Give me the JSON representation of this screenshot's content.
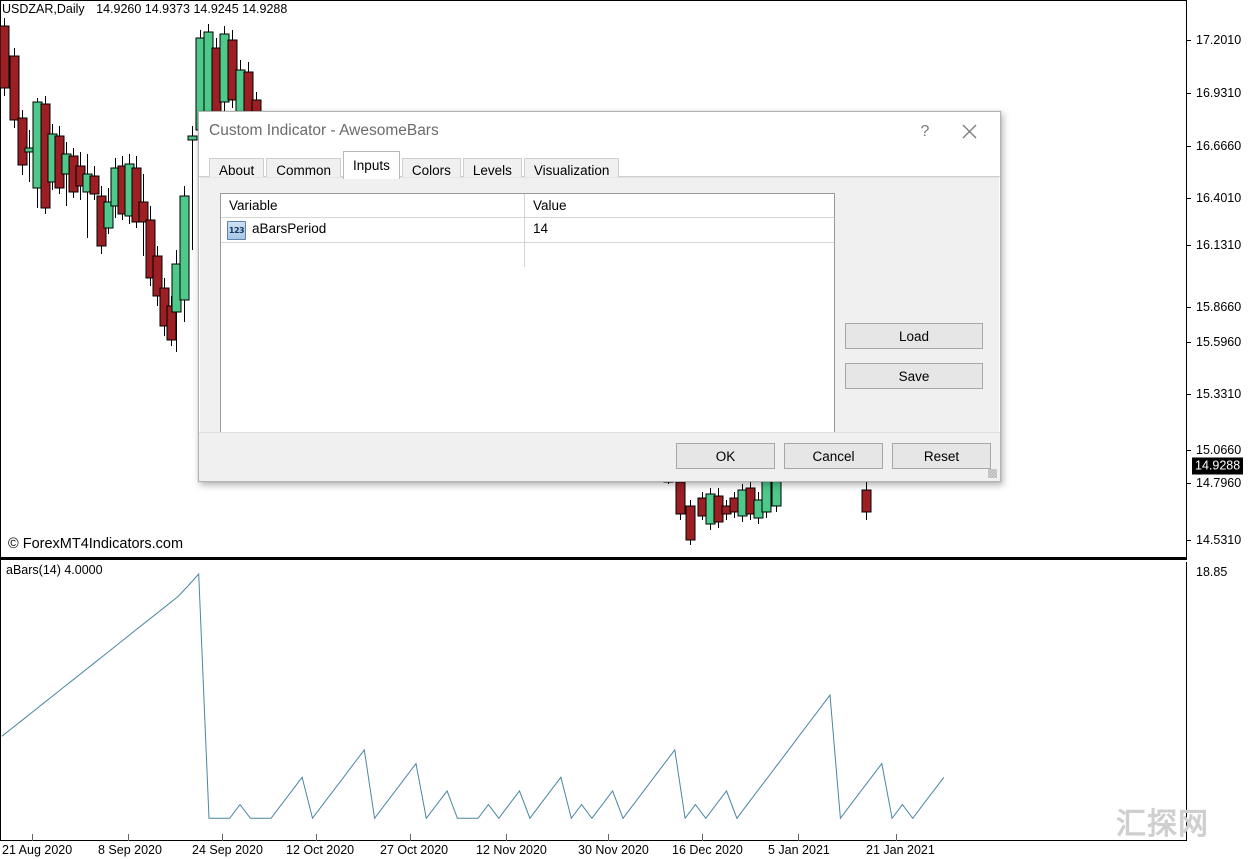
{
  "chart": {
    "symbol_period": "USDZAR,Daily",
    "ohlc": "14.9260 14.9373 14.9245 14.9288",
    "copyright": "© ForexMT4Indicators.com",
    "watermark": "汇探网",
    "indicator_label": "aBars(14) 4.0000",
    "current_price_label": "14.9288",
    "price_labels": [
      "17.2010",
      "16.9310",
      "16.6660",
      "16.4010",
      "16.1310",
      "15.8660",
      "15.5960",
      "15.3310",
      "15.0660",
      "14.7960",
      "14.5310"
    ],
    "sub_price_labels": [
      "18.85"
    ],
    "date_labels": [
      "21 Aug 2020",
      "8 Sep 2020",
      "24 Sep 2020",
      "12 Oct 2020",
      "27 Oct 2020",
      "12 Nov 2020",
      "30 Nov 2020",
      "16 Dec 2020",
      "5 Jan 2021",
      "21 Jan 2021"
    ],
    "colors": {
      "bull_body": "#4ec98a",
      "bear_body": "#9b1f23",
      "candle_outline": "#000000",
      "indicator_line": "#4b86a0",
      "current_price_bg": "#000000",
      "current_price_fg": "#ffffff"
    }
  },
  "chart_data": {
    "type": "line",
    "title": "aBars(14)",
    "xlabel": "",
    "ylabel": "",
    "ylim": [
      0,
      18.85
    ],
    "grid": false,
    "legend": "none",
    "axis_top_label": "18.85",
    "last_value": 4.0,
    "x_tick_labels": [
      "21 Aug 2020",
      "8 Sep 2020",
      "24 Sep 2020",
      "12 Oct 2020",
      "27 Oct 2020",
      "12 Nov 2020",
      "30 Nov 2020",
      "16 Dec 2020",
      "5 Jan 2021",
      "21 Jan 2021"
    ],
    "series": [
      {
        "name": "aBars(14)",
        "color": "#4b86a0",
        "values": [
          7.0,
          7.6,
          8.2,
          8.8,
          9.4,
          10.0,
          10.6,
          11.2,
          11.8,
          12.4,
          13.0,
          13.6,
          14.2,
          14.8,
          15.4,
          16.0,
          16.6,
          17.2,
          18.0,
          18.85,
          1.0,
          1.0,
          1.0,
          2.0,
          1.0,
          1.0,
          1.0,
          2.0,
          3.0,
          4.0,
          1.0,
          2.0,
          3.0,
          4.0,
          5.0,
          6.0,
          1.0,
          2.0,
          3.0,
          4.0,
          5.0,
          1.0,
          2.0,
          3.0,
          1.0,
          1.0,
          1.0,
          2.0,
          1.0,
          2.0,
          3.0,
          1.0,
          2.0,
          3.0,
          4.0,
          1.0,
          2.0,
          1.0,
          2.0,
          3.0,
          1.0,
          2.0,
          3.0,
          4.0,
          5.0,
          6.0,
          1.0,
          2.0,
          1.0,
          2.0,
          3.0,
          1.0,
          2.0,
          3.0,
          4.0,
          5.0,
          6.0,
          7.0,
          8.0,
          9.0,
          10.0,
          1.0,
          2.0,
          3.0,
          4.0,
          5.0,
          1.0,
          2.0,
          1.0,
          2.0,
          3.0,
          4.0
        ]
      }
    ]
  },
  "candles": {
    "bull_color": "#4ec98a",
    "bear_color": "#9b1f23"
  },
  "dialog": {
    "title": "Custom Indicator - AwesomeBars",
    "help_icon": "?",
    "close_icon": "✕",
    "tabs": [
      {
        "label": "About",
        "active": false
      },
      {
        "label": "Common",
        "active": false
      },
      {
        "label": "Inputs",
        "active": true
      },
      {
        "label": "Colors",
        "active": false
      },
      {
        "label": "Levels",
        "active": false
      },
      {
        "label": "Visualization",
        "active": false
      }
    ],
    "grid": {
      "columns": [
        "Variable",
        "Value"
      ],
      "rows": [
        {
          "icon": "123",
          "variable": "aBarsPeriod",
          "value": "14"
        }
      ]
    },
    "side_buttons": {
      "load": "Load",
      "save": "Save"
    },
    "footer_buttons": {
      "ok": "OK",
      "cancel": "Cancel",
      "reset": "Reset"
    }
  }
}
